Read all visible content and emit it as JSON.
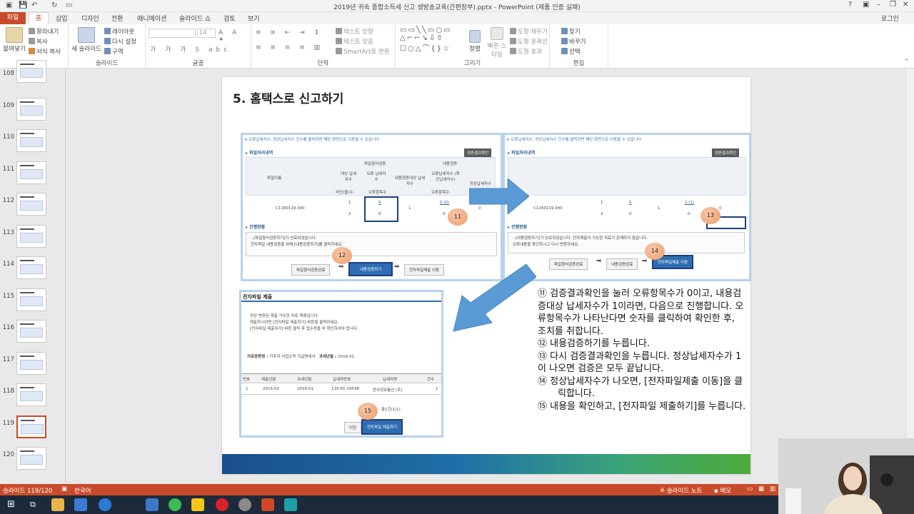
{
  "window": {
    "title": "2019년 귀속 종합소득세 신고 생방송교육(간편장부).pptx - PowerPoint (제품 인증 실패)",
    "help": "?",
    "user": "로그인"
  },
  "tabs": [
    "파일",
    "홈",
    "삽입",
    "디자인",
    "전환",
    "애니메이션",
    "슬라이드 쇼",
    "검토",
    "보기"
  ],
  "ribbon": {
    "clipboard": {
      "label": "클립보드",
      "paste": "붙여넣기",
      "cut": "잘라내기",
      "copy": "복사",
      "format_painter": "서식 복사"
    },
    "slides": {
      "label": "슬라이드",
      "new_slide": "새 슬라이드",
      "layout": "레이아웃",
      "reset": "다시 설정",
      "section": "구역"
    },
    "font": {
      "label": "글꼴",
      "size": "14"
    },
    "paragraph": {
      "label": "단락",
      "text_direction": "텍스트 방향",
      "align_text": "텍스트 맞춤",
      "smartart": "SmartArt로 변환"
    },
    "drawing": {
      "label": "그리기",
      "arrange": "정렬",
      "quick_styles": "빠른 스타일",
      "shape_fill": "도형 채우기",
      "shape_outline": "도형 윤곽선",
      "shape_effects": "도형 효과"
    },
    "editing": {
      "label": "편집",
      "find": "찾기",
      "replace": "바꾸기",
      "select": "선택"
    }
  },
  "thumbnails": [
    {
      "num": "108"
    },
    {
      "num": "109"
    },
    {
      "num": "110"
    },
    {
      "num": "111"
    },
    {
      "num": "112"
    },
    {
      "num": "113"
    },
    {
      "num": "114"
    },
    {
      "num": "115"
    },
    {
      "num": "116"
    },
    {
      "num": "117"
    },
    {
      "num": "118"
    },
    {
      "num": "119"
    },
    {
      "num": "120"
    }
  ],
  "slide": {
    "title": "5. 홈택스로 신고하기",
    "shot1": {
      "hint": "※ 오류납세자수, 정상납세자수 건수를 클릭하면 해당 화면으로 이동할 수 있습니다.",
      "section1": "▸ 파일처리내역",
      "btn_check": "검증결과확인",
      "col_filename": "파일이름",
      "col_format": "파일형식검증",
      "col_content": "내용검증",
      "col_target": "대상 납세자수",
      "col_error": "오류 납세자수",
      "col_content_target": "내용검증대상 납세자수",
      "col_error2": "오류납세자수 (확인납세자수)",
      "col_normal": "정상납세자수",
      "col_lines": "라인(줄)수",
      "col_errcount": "오류항목수",
      "col_errcount2": "오류항목수",
      "filename": "C1160119.340",
      "v1": "1",
      "v2": "2",
      "v3": "0",
      "v4": "0",
      "v5": "1",
      "v6": "0 (0)",
      "v7": "0",
      "v8": "0",
      "section2": "▸ 진행현황",
      "note1": "- [파일형식검증하기]가 완료되었습니다.",
      "note2": "전자파일 내용검증을 위해 [내용검증하기]를 클릭하세요.",
      "step1": "파일형식검증완료",
      "step2": "내용검증하기",
      "step3": "전자파일제출 이동"
    },
    "shot2": {
      "hint": "※ 오류납세자수, 정상납세자수 건수를 클릭하면 해당 화면으로 이동할 수 있습니다.",
      "section1": "▸ 파일처리내역",
      "btn_check": "검증결과확인",
      "filename": "C1160119.340",
      "v1": "1",
      "v2": "2",
      "v3": "0",
      "v4": "0",
      "v5": "1",
      "v6": "1 (1)",
      "v7": "0",
      "v8": "0",
      "section2": "▸ 진행현황",
      "note1": "- [내용검증하기]가 완료되었습니다. 전자제출이 가능한 자료가 존재하지 않습니다.",
      "note2": "오류내용을 확인하시고 다시 변환하세요.",
      "step1": "파일형식검증완료",
      "step2": "내용검증완료",
      "step3": "전자파일제출 이동"
    },
    "shot3": {
      "title": "전자파일 제출",
      "line1": "정상 변환된 제출 가능한 자료 목록입니다.",
      "line2": "제출하시려면 [전자파일 제출하기] 버튼을 클릭하세요.",
      "line3": "[전자파일 제출하기] 버튼 클릭 후 접수증을 꼭 확인하셔야 합니다.",
      "field_label": "자료종류명 : ",
      "field_value": "거주자 사업소득 지급명세서",
      "period_label": "과세년월 : ",
      "period_value": "2016-01",
      "headers": [
        "번호",
        "제출년월",
        "과세년월",
        "납세자번호",
        "납세자명",
        "건수"
      ],
      "row": [
        "1",
        "2015-02",
        "2016-01",
        "116-81-19548",
        "한국정보통신 (주)",
        "1"
      ],
      "pagination": "총1건(1/1)",
      "btn_prev": "이전",
      "btn_submit": "전자파일 제출하기"
    },
    "badges": [
      "11",
      "12",
      "13",
      "14",
      "15"
    ],
    "explain": [
      "⑪ 검증결과확인을 눌러 오류항목수가 0이고, 내용검증대상 납세자수가 1이라면, 다음으로 진행합니다. 오류항목수가 나타난다면 숫자를 클릭하여 확인한 후, 조치를 취합니다.",
      "⑫ 내용검증하기를 누릅니다.",
      "⑬ 다시 검증결과확인을 누릅니다. 정상납세자수가 1이 나오면 검증은 모두 끝납니다.",
      "⑭  정상납세자수가 나오면, [전자파일제출 이동]을 클릭합니다.",
      "⑮  내용을 확인하고, [전자파일 제출하기]를 누릅니다."
    ]
  },
  "status": {
    "slide_info": "슬라이드 119/120",
    "language": "한국어",
    "notes": "슬라이드 노트",
    "comments": "메모"
  },
  "colors": {
    "accent": "#c84b29",
    "shot_border": "#b7d2ec",
    "highlight": "#1e3f7a",
    "arrow": "#5b9bd5"
  }
}
